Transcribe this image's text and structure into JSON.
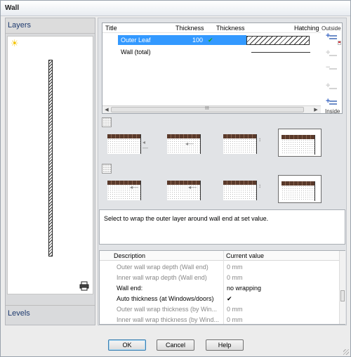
{
  "window": {
    "title": "Wall"
  },
  "left_panel": {
    "layers_label": "Layers",
    "levels_label": "Levels"
  },
  "layers_table": {
    "columns": [
      "Title",
      "Thickness",
      "Thickness",
      "Hatching"
    ],
    "rows": [
      {
        "title": "Outer Leaf",
        "thickness": "100",
        "auto_thickness": "✔",
        "selected": true
      },
      {
        "title": "Wall (total)",
        "thickness": "",
        "auto_thickness": "",
        "selected": false
      }
    ],
    "scroll_mark": "III"
  },
  "layer_tools": {
    "outside_label": "Outside",
    "inside_label": "Inside"
  },
  "description": "Select to wrap the outer layer around wall end at set value.",
  "properties": {
    "columns": [
      "Description",
      "Current value"
    ],
    "rows": [
      {
        "desc": "Outer wall wrap depth (Wall end)",
        "value": "0 mm",
        "enabled": false
      },
      {
        "desc": "Inner wall wrap depth (Wall end)",
        "value": "0 mm",
        "enabled": false
      },
      {
        "desc": "Wall end:",
        "value": "no wrapping",
        "enabled": true
      },
      {
        "desc": "Auto thickness (at Windows/doors)",
        "value": "✔",
        "enabled": true
      },
      {
        "desc": "Outer wall wrap thickness (by Win...",
        "value": "0 mm",
        "enabled": false
      },
      {
        "desc": "Inner wall wrap thickness (by Wind...",
        "value": "0 mm",
        "enabled": false
      }
    ]
  },
  "buttons": {
    "ok": "OK",
    "cancel": "Cancel",
    "help": "Help"
  },
  "colors": {
    "selection": "#3399ff",
    "check": "#1aa31a",
    "brick": "#5a3a2b",
    "accent": "#3a66c4"
  }
}
